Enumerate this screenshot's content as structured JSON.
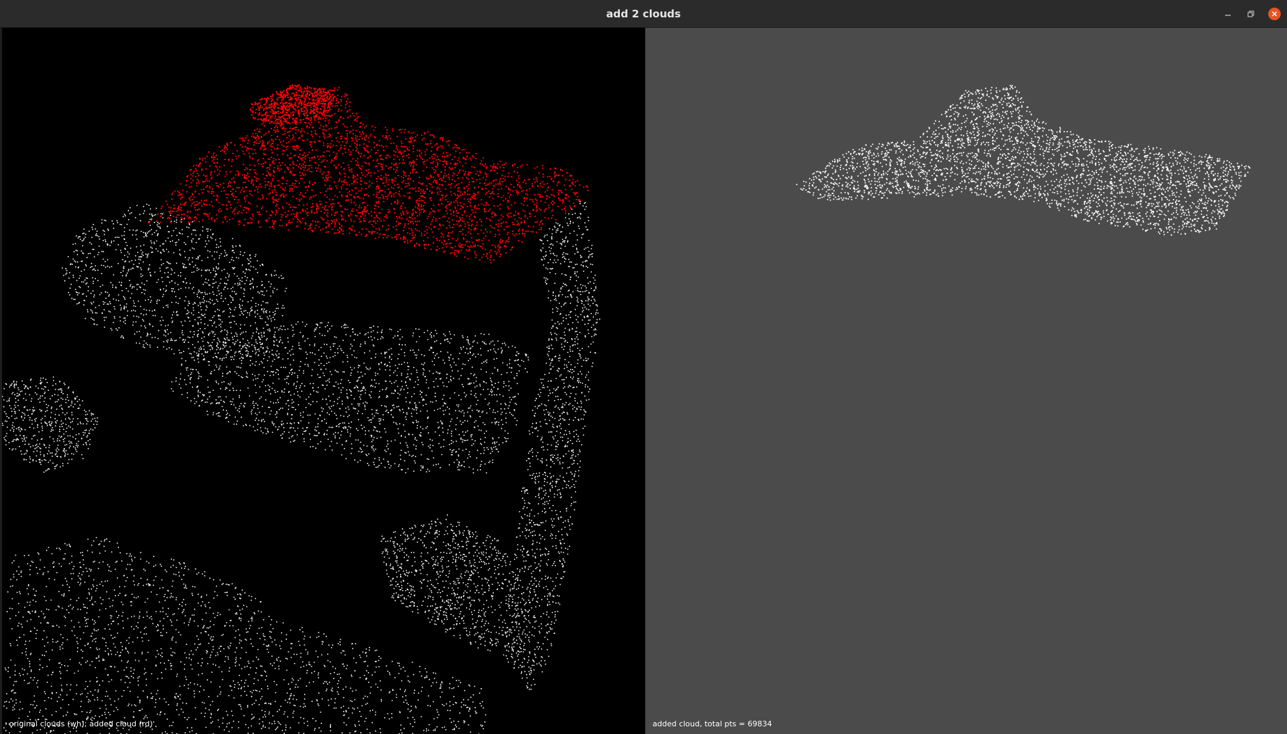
{
  "window": {
    "title": "add 2 clouds"
  },
  "left_viewport": {
    "caption": "original clouds (wh); added cloud (rd)",
    "background": "#000000",
    "colors": {
      "original": "#ffffff",
      "added": "#ff0000"
    }
  },
  "right_viewport": {
    "caption": "added cloud, total pts = 69834",
    "background": "#4b4b4b",
    "colors": {
      "cloud": "#ffffff"
    }
  },
  "colors": {
    "titlebar": "#2b2b2b",
    "close_button": "#e95420"
  }
}
